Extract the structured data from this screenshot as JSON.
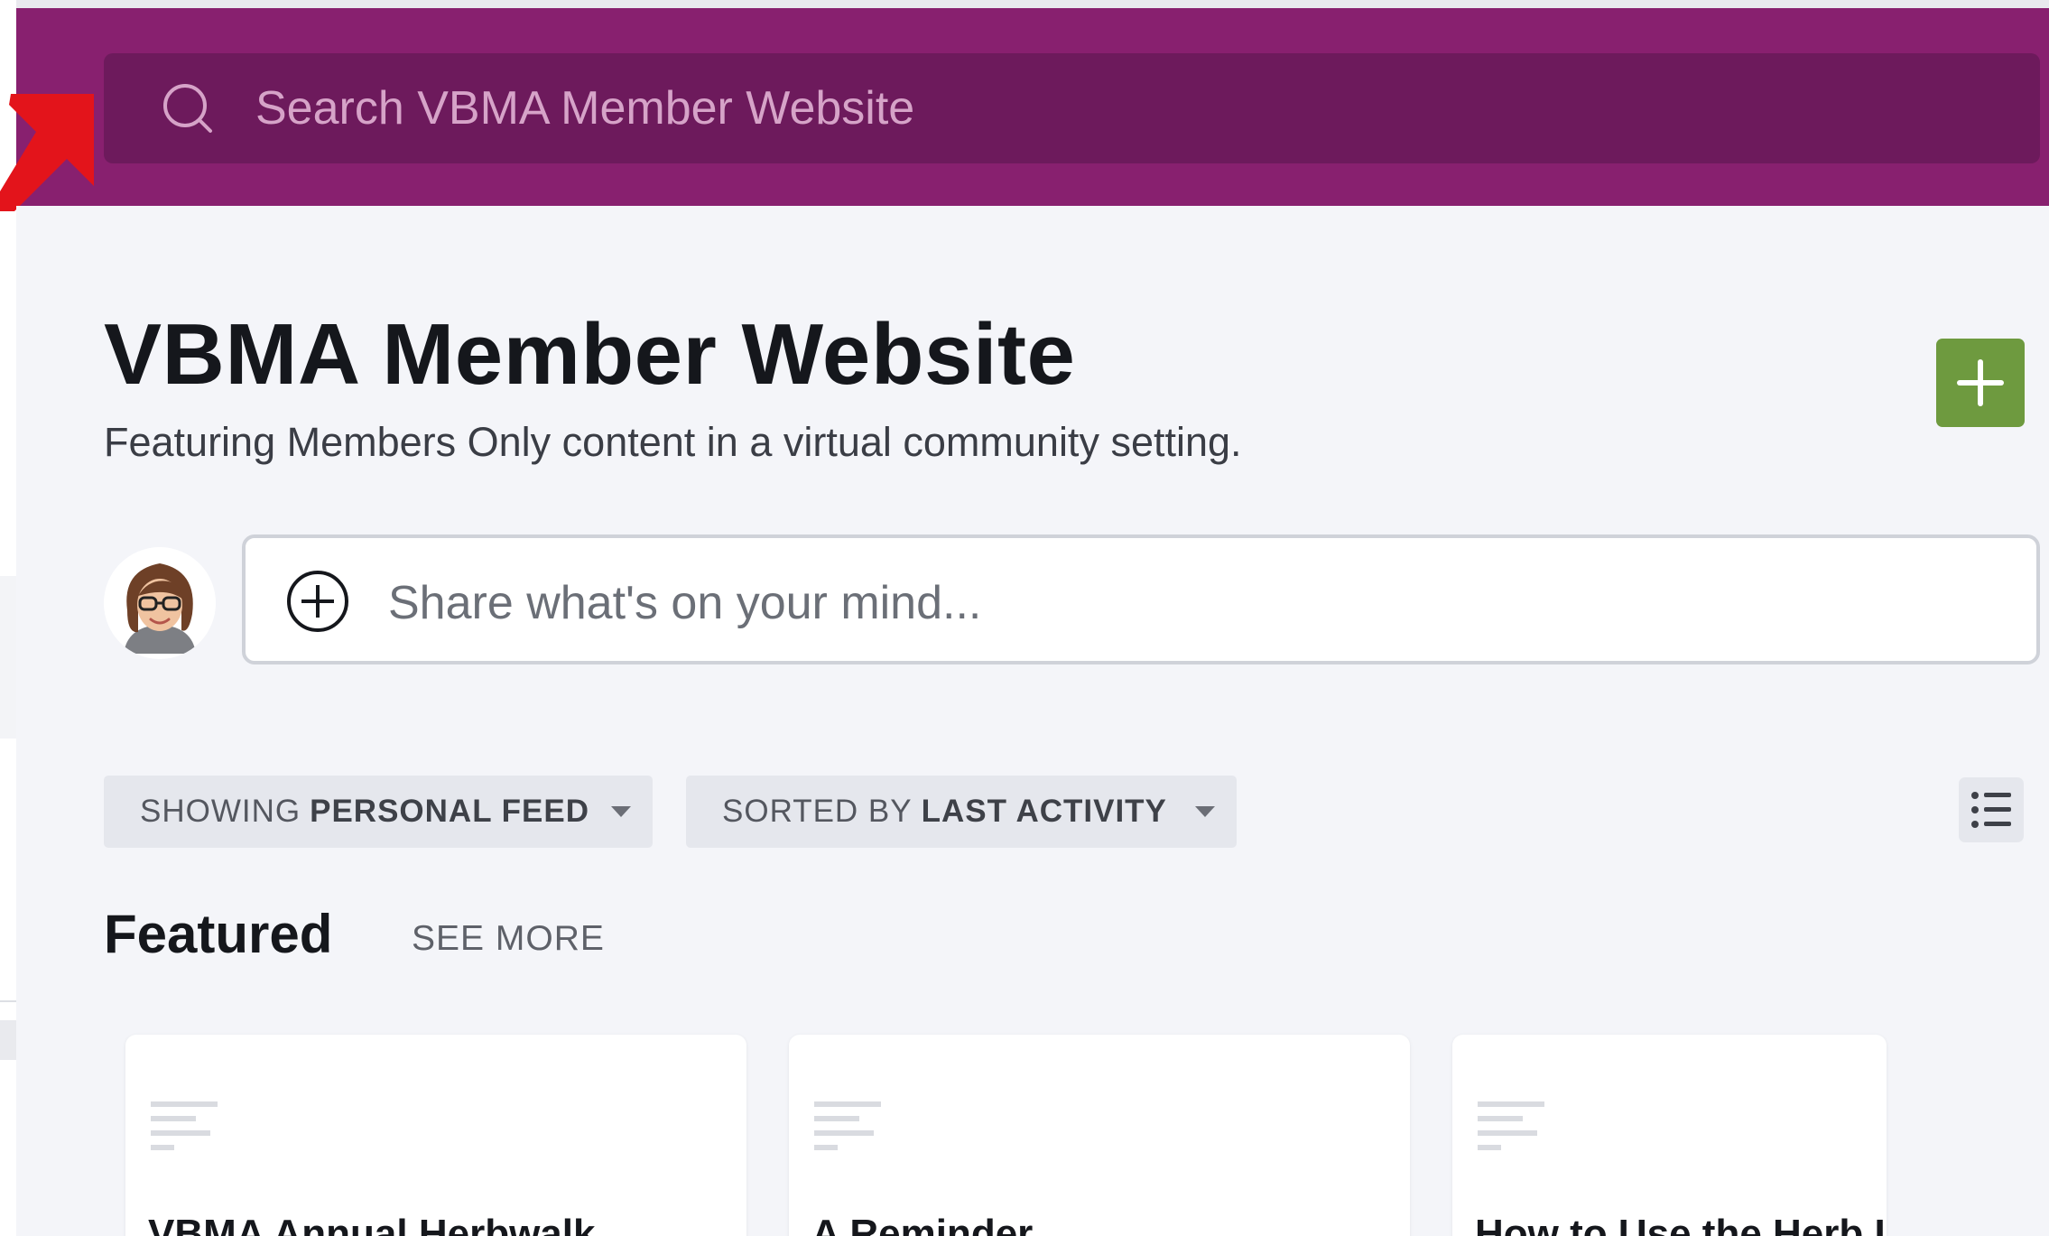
{
  "header": {
    "search_placeholder": "Search VBMA Member Website",
    "search_value": ""
  },
  "community": {
    "title": "VBMA Member Website",
    "subtitle": "Featuring Members Only content in a virtual community setting."
  },
  "composer": {
    "placeholder": "Share what's on your mind..."
  },
  "filters": {
    "feed_prefix": "SHOWING",
    "feed_value": "PERSONAL FEED",
    "sort_prefix": "SORTED BY",
    "sort_value": "LAST ACTIVITY"
  },
  "featured": {
    "heading": "Featured",
    "see_more": "SEE MORE",
    "cards": [
      {
        "title": "VBMA Annual Herbwalk"
      },
      {
        "title": "A Reminder"
      },
      {
        "title": "How to Use the Herb I"
      }
    ]
  },
  "icons": {
    "search": "search-icon",
    "add": "plus-icon",
    "composer": "add-circle-icon",
    "list_view": "list-icon",
    "card_type": "text-lines-icon",
    "annotation": "red-arrow"
  },
  "colors": {
    "header_bg": "#88206f",
    "search_bg": "#6d1a5c",
    "page_bg": "#f4f5f9",
    "add_button": "#6e9a3f",
    "annotation_arrow": "#e3141b"
  }
}
